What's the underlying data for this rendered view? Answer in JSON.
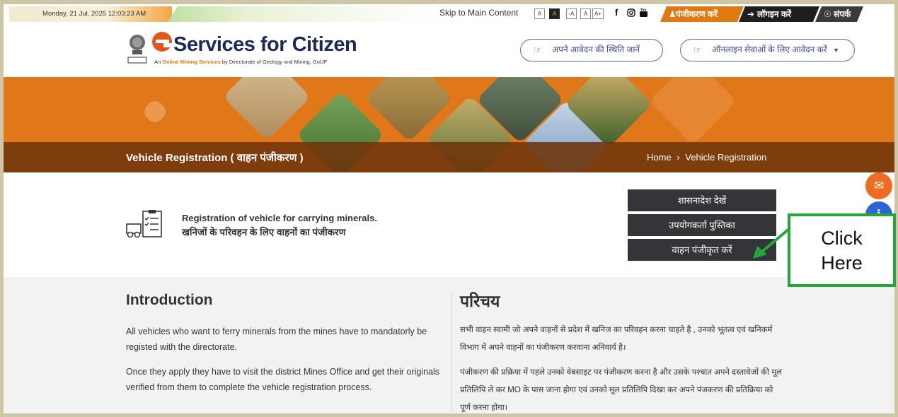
{
  "topbar": {
    "date": "Monday, 21 Jul, 2025 12:03:23 AM",
    "skip_label": "Skip to Main Content",
    "font_buttons": [
      "A",
      "A",
      "-A",
      "A",
      "A+"
    ],
    "social_icons": [
      "facebook-icon",
      "instagram-icon",
      "youtube-icon"
    ],
    "register_label": "पंजीकरण करें",
    "login_label": "लॉगइन करें",
    "contact_label": "संपर्क"
  },
  "header": {
    "logo_title": "Services for Citizen",
    "logo_sub_highlight": "Online Mining Services",
    "logo_sub_prefix": "An ",
    "logo_sub_suffix": " by Directorate of Geology and Mining, GoUP",
    "status_button": "अपने आवेदन की स्थिति जानें",
    "apply_button": "ऑनलाइन सेवाओं के लिए आवेदन करें"
  },
  "banner": {
    "heading": "Vehicle Registration ( वाहन पंजीकरण )",
    "breadcrumb_home": "Home",
    "breadcrumb_sep": "›",
    "breadcrumb_current": "Vehicle Registration"
  },
  "content": {
    "reg_title": "Registration of vehicle for carrying minerals.",
    "reg_sub": "खनिजों के परिवहन के लिए वाहनों का पंजीकरण",
    "buttons": [
      "शासनादेश देखें",
      "उपयोगकर्ता पुस्तिका",
      "वाहन पंजीकृत करें"
    ]
  },
  "annotation": {
    "line1": "Click",
    "line2": "Here",
    "color": "#22a83a"
  },
  "intro": {
    "heading_en": "Introduction",
    "heading_hi": "परिचय",
    "para1_en": "All vehicles who want to ferry minerals from the mines have to mandatorly be registed with the directorate.",
    "para2_en": "Once they apply they have to visit the district Mines Office and get their originals verified from them to complete the vehicle registration process.",
    "para1_hi": "सभी वाहन स्वामी जो अपने वाहनों से प्रदेश में खनिज का परिवहन करना चाहते है , उनको भूतत्व एवं खनिकर्म विभाग में अपने वाहनों का पंजीकरण करवाना अनिवार्य है।",
    "para2_hi": "पंजीकरण की प्रक्रिया में पहले उनको वेबसाइट पर पंजीकरण करना है और उसके पश्चात अपने दस्तावेजों की मूल प्रतिलिपि ले कर MO के पास जाना होगा एवं उनको मूल प्रतिलिपि दिखा कर अपने पंजकरण की प्रतिक्रिया को पूर्ण करना होगा।"
  },
  "colors": {
    "accent_orange": "#e0781a",
    "dark_button": "#333538",
    "brand_navy": "#1d2a55"
  }
}
